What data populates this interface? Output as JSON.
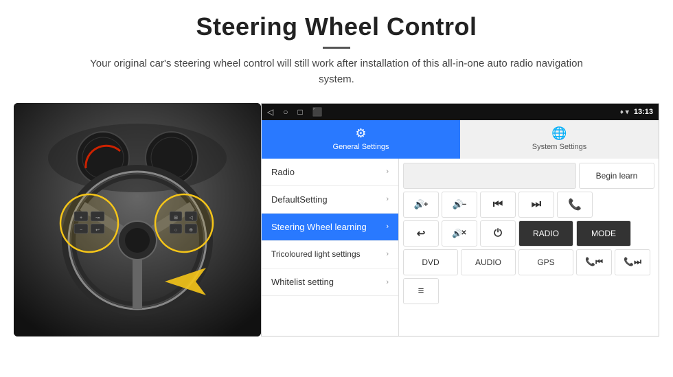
{
  "header": {
    "title": "Steering Wheel Control",
    "subtitle": "Your original car's steering wheel control will still work after installation of this all-in-one auto radio navigation system."
  },
  "status_bar": {
    "icons": [
      "◁",
      "○",
      "□",
      "⬛"
    ],
    "location_icon": "♦",
    "wifi_icon": "▼",
    "time": "13:13"
  },
  "tabs": [
    {
      "label": "General Settings",
      "active": true,
      "icon": "⚙"
    },
    {
      "label": "System Settings",
      "active": false,
      "icon": "🌐"
    }
  ],
  "menu_items": [
    {
      "label": "Radio",
      "active": false
    },
    {
      "label": "DefaultSetting",
      "active": false
    },
    {
      "label": "Steering Wheel learning",
      "active": true
    },
    {
      "label": "Tricoloured light settings",
      "active": false
    },
    {
      "label": "Whitelist setting",
      "active": false
    }
  ],
  "controls": {
    "begin_learn_label": "Begin learn",
    "row2_buttons": [
      "🔊+",
      "🔊−",
      "⏮",
      "⏭",
      "📞"
    ],
    "row3_buttons": [
      "↩",
      "🔊✕",
      "⏻",
      "RADIO",
      "MODE"
    ],
    "row4_buttons": [
      "DVD",
      "AUDIO",
      "GPS",
      "📞⏮",
      "📞⏭"
    ],
    "row5_buttons": [
      "📋"
    ]
  }
}
